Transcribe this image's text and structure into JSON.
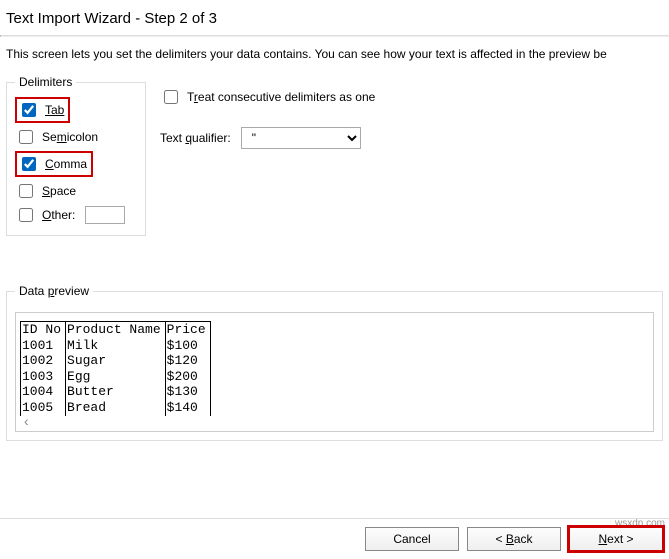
{
  "title": "Text Import Wizard - Step 2 of 3",
  "description": "This screen lets you set the delimiters your data contains.  You can see how your text is affected in the preview be",
  "delimiters": {
    "legend": "Delimiters",
    "tab": "Tab",
    "semicolon": "Semicolon",
    "comma": "Comma",
    "space": "Space",
    "other": "Other:"
  },
  "options": {
    "consecutive": "Treat consecutive delimiters as one",
    "qualifier_label": "Text qualifier:",
    "qualifier_value": "\""
  },
  "preview": {
    "legend": "Data preview",
    "headers": [
      "ID No",
      "Product Name",
      "Price"
    ],
    "rows": [
      [
        "1001",
        "Milk",
        "$100"
      ],
      [
        "1002",
        "Sugar",
        "$120"
      ],
      [
        "1003",
        "Egg",
        "$200"
      ],
      [
        "1004",
        "Butter",
        "$130"
      ],
      [
        "1005",
        "Bread",
        "$140"
      ]
    ]
  },
  "buttons": {
    "cancel": "Cancel",
    "back": "< Back",
    "next": "Next >"
  },
  "watermark": "wsxdn.com"
}
